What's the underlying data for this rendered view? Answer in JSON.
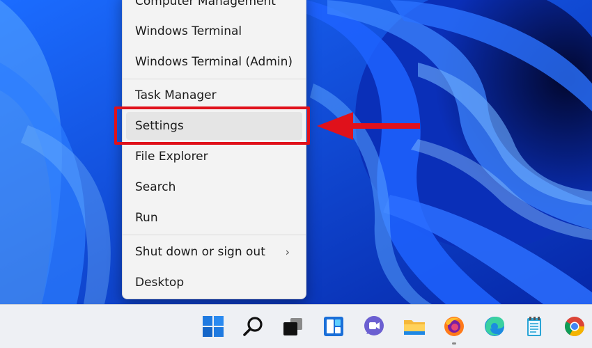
{
  "menu": {
    "items": [
      {
        "label": "Computer Management"
      },
      {
        "label": "Windows Terminal"
      },
      {
        "label": "Windows Terminal (Admin)"
      },
      {
        "label": "Task Manager"
      },
      {
        "label": "Settings"
      },
      {
        "label": "File Explorer"
      },
      {
        "label": "Search"
      },
      {
        "label": "Run"
      },
      {
        "label": "Shut down or sign out",
        "chevron": "›"
      },
      {
        "label": "Desktop"
      }
    ],
    "highlighted_item": "Settings"
  },
  "annotations": {
    "highlight_color": "#e0111b"
  },
  "taskbar": {
    "icons": [
      {
        "name": "start-icon"
      },
      {
        "name": "search-icon"
      },
      {
        "name": "task-view-icon"
      },
      {
        "name": "widgets-icon"
      },
      {
        "name": "chat-icon"
      },
      {
        "name": "file-explorer-icon"
      },
      {
        "name": "firefox-icon"
      },
      {
        "name": "edge-icon"
      },
      {
        "name": "notepad-icon"
      },
      {
        "name": "chrome-icon"
      }
    ]
  },
  "colors": {
    "wallpaper_base": "#0a3fd6",
    "menu_bg": "#f3f3f3",
    "taskbar_bg": "#eef0f4"
  }
}
